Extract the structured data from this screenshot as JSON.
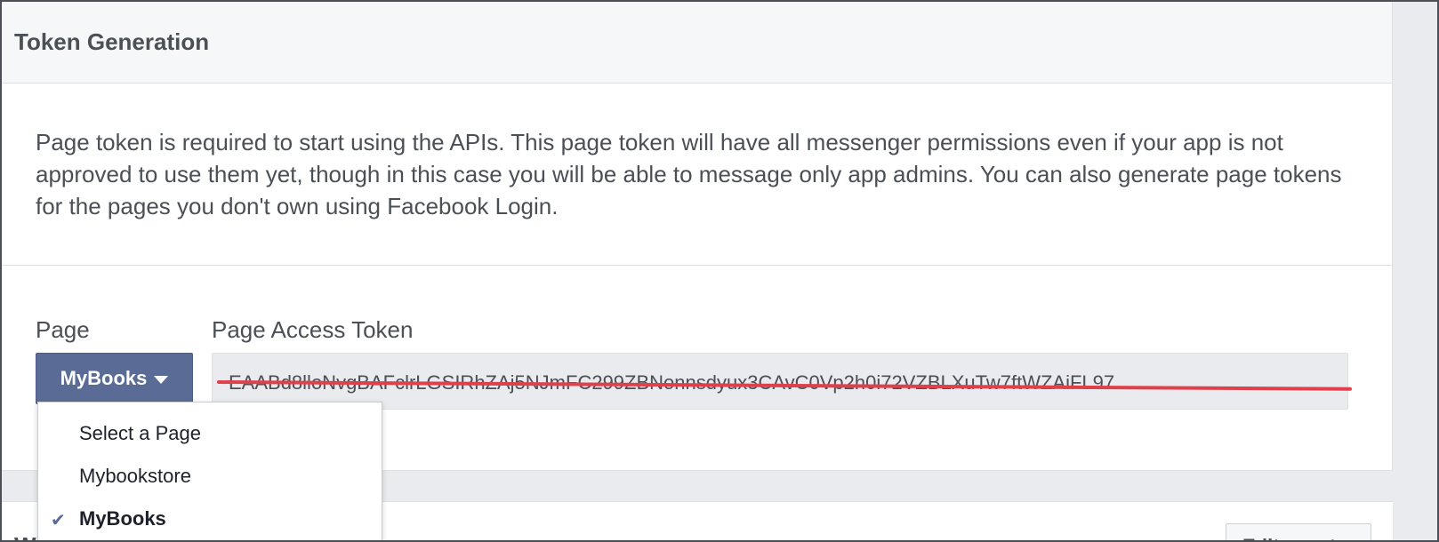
{
  "card": {
    "title": "Token Generation",
    "description": "Page token is required to start using the APIs. This page token will have all messenger permissions even if your app is not approved to use them yet, though in this case you will be able to message only app admins. You can also generate page tokens for the pages you don't own using Facebook Login."
  },
  "form": {
    "page_label": "Page",
    "token_label": "Page Access Token",
    "page_button_label": "MyBooks",
    "token_value": "EAABd8lloNvgBAFclrLGSIRhZAj5NJmFC299ZBNonnsdyux3CAvC0Vp2h0i72VZBLXuTw7ftWZAiFL97"
  },
  "dropdown": {
    "items": [
      {
        "label": "Select a Page",
        "selected": false
      },
      {
        "label": "Mybookstore",
        "selected": false
      },
      {
        "label": "MyBooks",
        "selected": true
      }
    ],
    "check_glyph": "✔"
  },
  "next_card": {
    "title_fragment": "W",
    "button_label": "Edit events"
  },
  "colors": {
    "primary_button": "#5a6c95",
    "strike": "#e0404a",
    "header_bg": "#f6f7f9"
  },
  "icons": {
    "caret": "caret-down-icon",
    "check": "checkmark-icon"
  }
}
